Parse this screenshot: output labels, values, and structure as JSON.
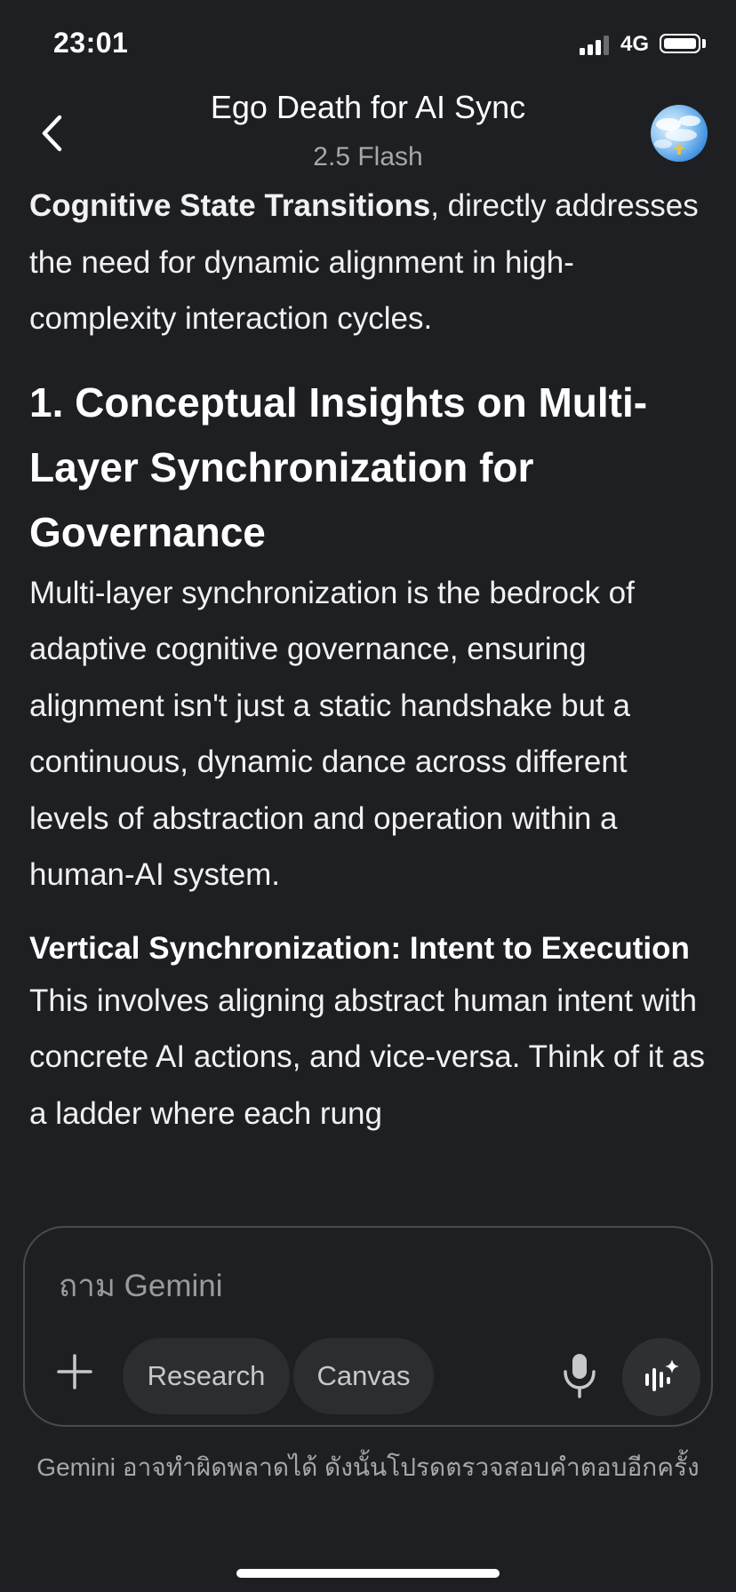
{
  "status_bar": {
    "time": "23:01",
    "network": "4G"
  },
  "header": {
    "title": "Ego Death for AI Sync",
    "model": "2.5 Flash"
  },
  "content": {
    "intro_bold": "Cognitive State Transitions",
    "intro_rest": ", directly addresses the need for dynamic alignment in high-complexity interaction cycles.",
    "heading1": "1. Conceptual Insights on Multi-Layer Synchronization for Governance",
    "para1": "Multi-layer synchronization is the bedrock of adaptive cognitive governance, ensuring alignment isn't just a static handshake but a continuous, dynamic dance across different levels of abstraction and operation within a human-AI system.",
    "heading2": "Vertical Synchronization: Intent to Execution",
    "para2": "This involves aligning abstract human intent with concrete AI actions, and vice-versa. Think of it as a ladder where each rung"
  },
  "input": {
    "placeholder": "ถาม Gemini",
    "chip_research": "Research",
    "chip_canvas": "Canvas"
  },
  "footer": {
    "disclaimer": "Gemini อาจทำผิดพลาดได้ ดังนั้นโปรดตรวจสอบคำตอบอีกครั้ง"
  },
  "icons": {
    "back": "chevron-left-icon",
    "plus": "plus-icon",
    "mic": "microphone-icon",
    "live": "sparkle-waveform-icon"
  },
  "colors": {
    "background": "#1e1f22",
    "text": "#ffffff",
    "muted": "#a6a7ab",
    "chip": "#2c2d31"
  }
}
